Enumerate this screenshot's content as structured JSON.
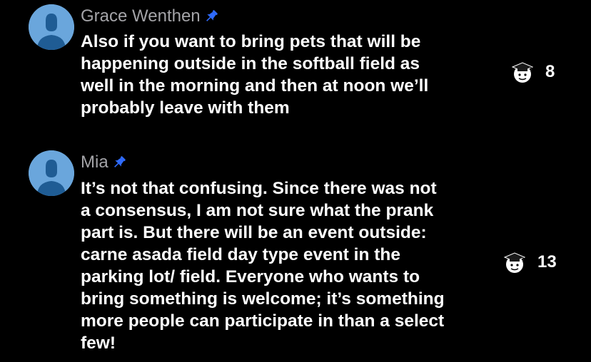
{
  "colors": {
    "background": "#000000",
    "author": "#a4a4a8",
    "pin": "#2f6bff",
    "avatar_bg": "#6aa6dc",
    "avatar_fg": "#1f5c94"
  },
  "comments": [
    {
      "author": "Grace Wenthen",
      "pinned_icon": "pin-icon",
      "avatar_icon": "person-icon",
      "lines": [
        "Also if you want to bring pets that will be",
        "happening outside in the softball field as",
        "well in the morning and then at noon we’ll",
        "probably leave with them"
      ],
      "vote_icon": "graduate-face-icon",
      "vote_count": "8"
    },
    {
      "author": "Mia",
      "pinned_icon": "pin-icon",
      "avatar_icon": "person-icon",
      "lines": [
        "It’s not that confusing. Since there was not",
        "a consensus, I am not sure what the prank",
        "part is. But there will be an event outside:",
        "carne asada field day type event in the",
        "parking lot/ field. Everyone who wants to",
        "bring something is welcome; it’s something",
        "more people can participate in than a select",
        "few!"
      ],
      "vote_icon": "graduate-face-icon",
      "vote_count": "13"
    }
  ]
}
